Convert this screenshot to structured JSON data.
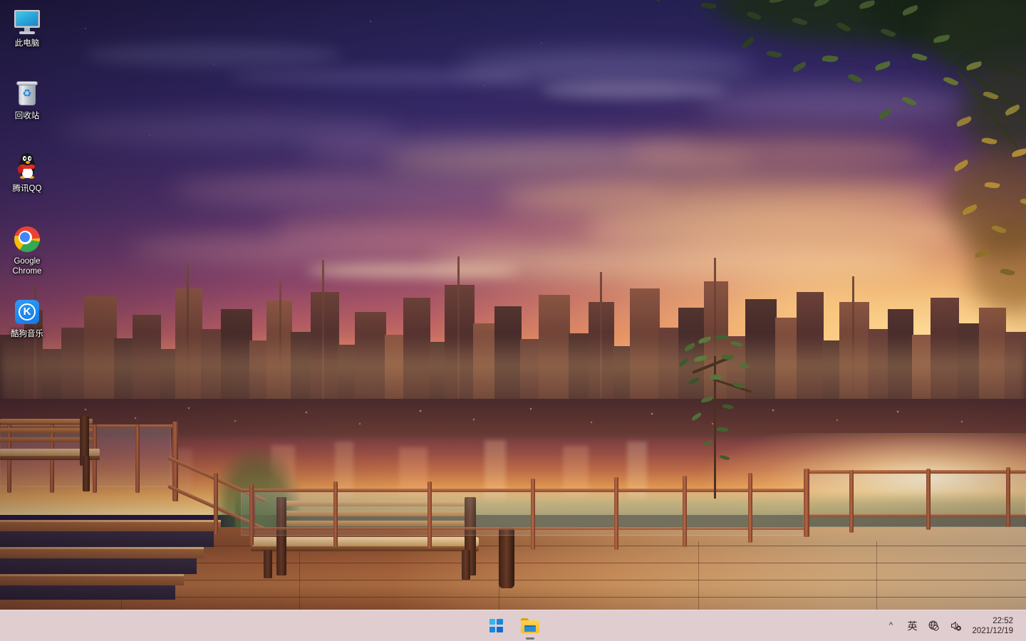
{
  "desktop": {
    "wallpaper_description": "Anime-style sunset cityscape seen from a wooden terrace with benches and railings, river reflecting golden light, tree branches framing the upper right",
    "icons": [
      {
        "label": "此电脑",
        "icon": "monitor-icon",
        "name": "this-pc"
      },
      {
        "label": "回收站",
        "icon": "recycle-bin-icon",
        "name": "recycle-bin"
      },
      {
        "label": "腾讯QQ",
        "icon": "qq-penguin-icon",
        "name": "tencent-qq"
      },
      {
        "label": "Google Chrome",
        "icon": "chrome-icon",
        "name": "google-chrome"
      },
      {
        "label": "酷狗音乐",
        "icon": "kugou-icon",
        "name": "kugou-music",
        "glyph": "K"
      }
    ]
  },
  "taskbar": {
    "background_color": "#f0dbdb",
    "buttons": [
      {
        "label": "开始",
        "icon": "windows-start-icon",
        "name": "start-button",
        "running": false
      },
      {
        "label": "文件资源管理器",
        "icon": "file-explorer-icon",
        "name": "file-explorer-button",
        "running": true
      }
    ],
    "tray": [
      {
        "label": "^",
        "icon": "chevron-up-icon",
        "name": "show-hidden-icons"
      },
      {
        "label": "英",
        "icon": "ime-language-icon",
        "name": "input-method-indicator"
      },
      {
        "label": "",
        "icon": "network-globe-no-internet-icon",
        "name": "network-status"
      },
      {
        "label": "",
        "icon": "speaker-muted-icon",
        "name": "volume-status"
      }
    ],
    "clock": {
      "time": "22:52",
      "date": "2021/12/19"
    }
  }
}
